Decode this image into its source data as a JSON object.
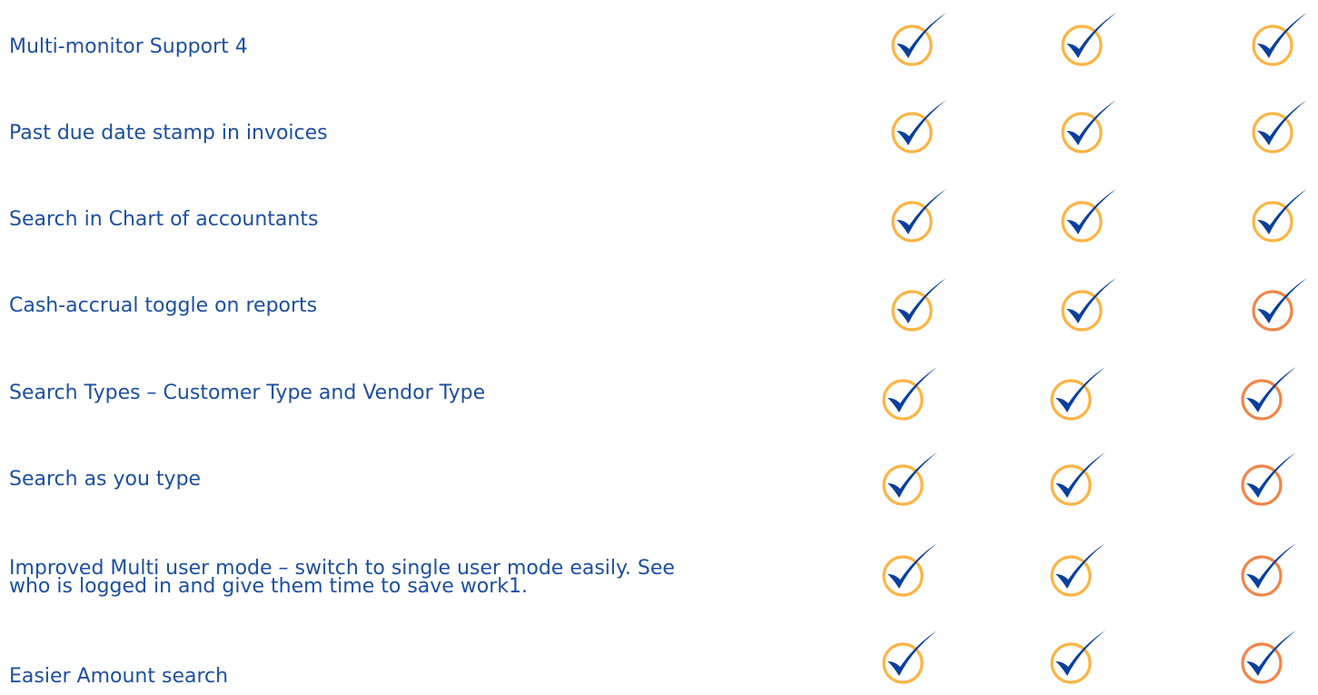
{
  "colors": {
    "text": "#1d4fa0",
    "check": "#0a3f9c",
    "circle_yellow": "#fbb445",
    "circle_orange": "#f0864a"
  },
  "icons": {
    "check": "check-circle-icon"
  },
  "rows": [
    {
      "label_lines": [
        "Multi-monitor Support 4"
      ],
      "checks": [
        "yellow",
        "yellow",
        "yellow"
      ]
    },
    {
      "label_lines": [
        "Past due date stamp in invoices"
      ],
      "checks": [
        "yellow",
        "yellow",
        "yellow"
      ]
    },
    {
      "label_lines": [
        "Search in Chart of accountants"
      ],
      "checks": [
        "yellow",
        "yellow",
        "yellow"
      ]
    },
    {
      "label_lines": [
        "Cash-accrual toggle on reports"
      ],
      "checks": [
        "yellow",
        "yellow",
        "orange"
      ]
    },
    {
      "label_lines": [
        "Search Types – Customer Type and Vendor Type"
      ],
      "checks": [
        "yellow",
        "yellow",
        "orange"
      ]
    },
    {
      "label_lines": [
        "Search as you type"
      ],
      "checks": [
        "yellow",
        "yellow",
        "orange"
      ]
    },
    {
      "label_lines": [
        "Improved Multi user mode – switch to single user mode easily. See",
        "who is logged in and give them time to save work1."
      ],
      "checks": [
        "yellow",
        "yellow",
        "orange"
      ]
    },
    {
      "label_lines": [
        "Easier Amount search"
      ],
      "checks": [
        "yellow",
        "yellow",
        "orange"
      ]
    }
  ]
}
